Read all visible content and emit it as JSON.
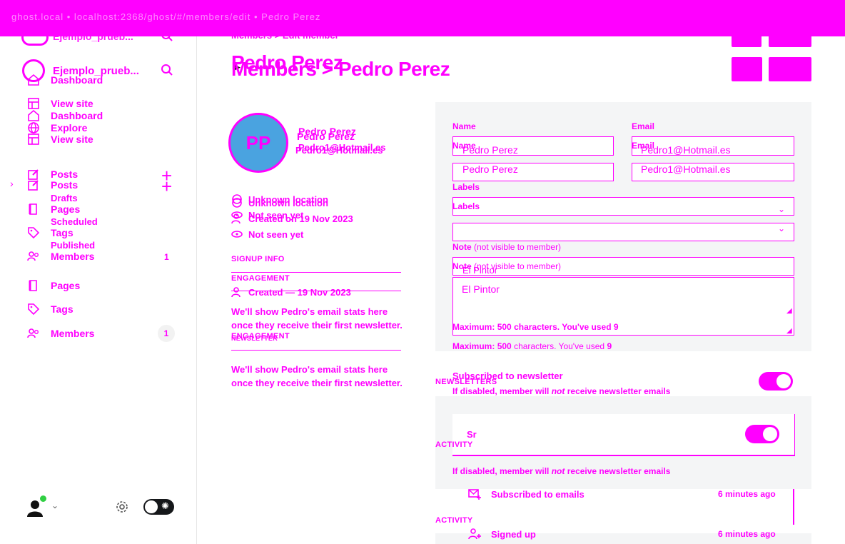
{
  "topbar": {
    "text": "ghost.local • localhost:2368/ghost/#/members/edit • Pedro Perez"
  },
  "sidebar": {
    "site_name": "Ejemplo_prueb...",
    "nav": [
      {
        "label": "Dashboard",
        "icon": "house-icon"
      },
      {
        "label": "View site",
        "icon": "layout-icon"
      },
      {
        "label": "Dashboard",
        "icon": "house-icon"
      },
      {
        "label": "Explore",
        "icon": "globe-icon"
      },
      {
        "label": "View site",
        "icon": "layout-icon"
      }
    ],
    "posts": {
      "label": "Posts",
      "sub": [
        "Drafts",
        "Scheduled",
        "Published"
      ]
    },
    "pages_label": "Pages",
    "tags_label": "Tags",
    "members_label": "Members",
    "members_count": "1"
  },
  "header": {
    "breadcrumb": "Members > Edit member",
    "title": "Members > Pedro Perez",
    "title_ghost": "Pedro Perez"
  },
  "member": {
    "initials": "PP",
    "name": "Pedro Perez",
    "email": "Pedro1@Hotmail.es",
    "location": "Unknown location",
    "created": "Created on 19 Nov 2023",
    "created_short": "Created — 19 Nov 2023",
    "seen": "Not seen yet",
    "signup_info": "SIGNUP INFO",
    "engagement": "ENGAGEMENT",
    "newsletter": "NEWSLETTER",
    "engagement_text": "We'll show Pedro's email stats here once they receive their first newsletter."
  },
  "form": {
    "name_label": "Name",
    "name_value": "Pedro Perez",
    "email_label": "Email",
    "email_value": "Pedro1@Hotmail.es",
    "labels_label": "Labels",
    "note_label": "Note",
    "note_hint": "(not visible to member)",
    "note_value": "El Pintor",
    "max_prefix": "Maximum:",
    "max_value": "500",
    "max_suffix": "characters. You've used",
    "used_value": "9"
  },
  "newsletters": {
    "section_label": "NEWSLETTERS",
    "subscribed_label": "Subscribed to newsletter",
    "disabled_prefix": "If disabled, member will",
    "disabled_not": "not",
    "disabled_suffix": "receive newsletter emails",
    "item_label": "Sr",
    "subscribed": true
  },
  "activity": {
    "section_label": "ACTIVITY",
    "items": [
      {
        "label": "Subscribed to emails",
        "time": "6 minutes ago",
        "icon": "mail-plus-icon"
      },
      {
        "label": "Signed up",
        "time": "6 minutes ago",
        "icon": "user-plus-icon"
      }
    ]
  },
  "colors": {
    "accent": "#ff00ff",
    "panel": "#f4f5f6",
    "avatar": "#4aa3e0"
  }
}
